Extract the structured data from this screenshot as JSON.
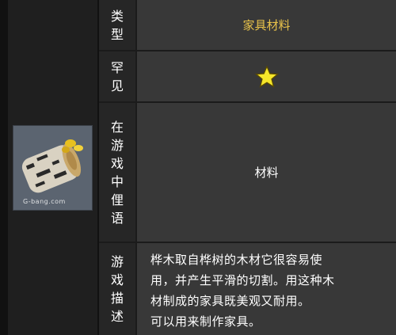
{
  "thumbnail": {
    "icon": "birch-wood-log",
    "caption": "G-bang.com"
  },
  "rows": [
    {
      "label_chars": [
        "类",
        "型"
      ],
      "value": "家具材料",
      "value_color": "#e8c24a"
    },
    {
      "label_chars": [
        "罕",
        "见"
      ],
      "value_icon": "star-icon",
      "stars": 1,
      "star_color": "#f5e62a"
    },
    {
      "label_chars": [
        "在",
        "游",
        "戏",
        "中",
        "俚",
        "语"
      ],
      "value": "材料"
    },
    {
      "label_chars": [
        "游",
        "戏",
        "描",
        "述"
      ],
      "description_lines": [
        "桦木取自桦树的木材它很容易使",
        "用，并产生平滑的切割。用这种木",
        "材制成的家具既美观又耐用。",
        "可以用来制作家具。"
      ]
    }
  ],
  "colors": {
    "label_bg": "#262626",
    "value_bg": "#383838",
    "page_bg": "#1b1b1b"
  }
}
